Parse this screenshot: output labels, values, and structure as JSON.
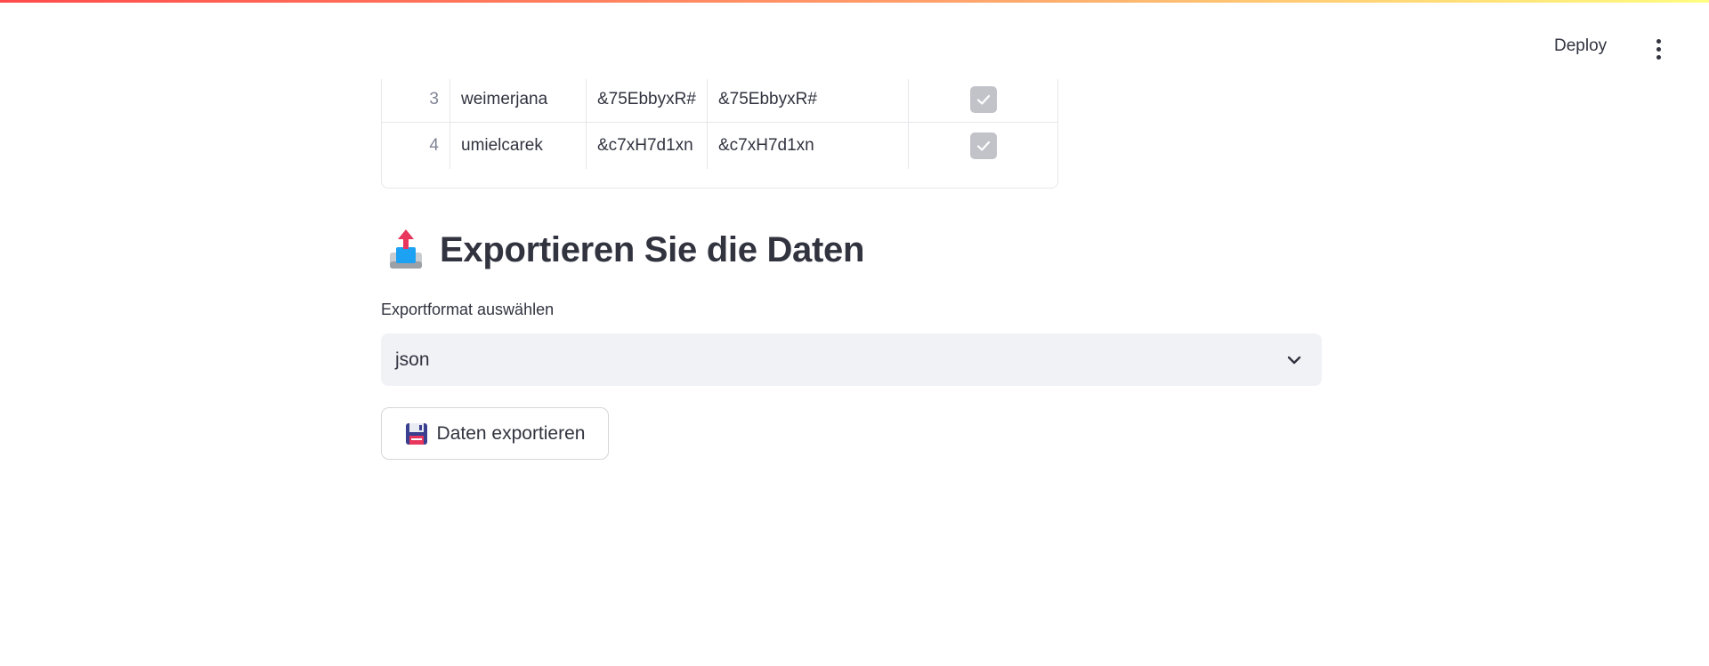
{
  "header": {
    "deploy_label": "Deploy",
    "menu_icon": "vertical-dots-icon"
  },
  "table": {
    "rows": [
      {
        "index": "",
        "username": "",
        "password": "",
        "password_confirm": "",
        "checked": true
      },
      {
        "index": "3",
        "username": "weimerjana",
        "password": "&75EbbyxR#",
        "password_confirm": "&75EbbyxR#",
        "checked": true
      },
      {
        "index": "4",
        "username": "umielcarek",
        "password": "&c7xH7d1xn",
        "password_confirm": "&c7xH7d1xn",
        "checked": true
      }
    ]
  },
  "export_section": {
    "icon": "outbox-tray-icon",
    "title": "Exportieren Sie die Daten",
    "select_label": "Exportformat auswählen",
    "select_value": "json",
    "button_icon": "floppy-disk-icon",
    "button_label": "Daten exportieren"
  },
  "colors": {
    "accent_gradient_start": "#ff4b4b",
    "accent_gradient_end": "#fffd80",
    "text": "#31333f",
    "select_bg": "#f0f2f6",
    "checkbox_bg": "#c2c3c9"
  }
}
